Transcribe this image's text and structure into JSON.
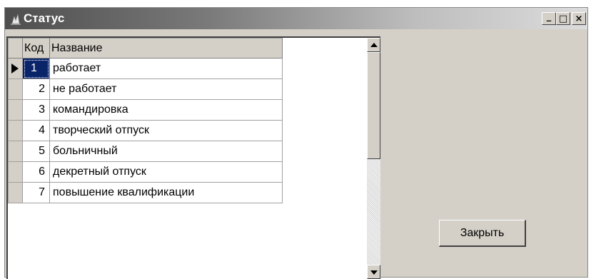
{
  "window": {
    "title": "Статус",
    "buttons": {
      "minimize": "_",
      "maximize": "□",
      "close": "×"
    }
  },
  "grid": {
    "columns": [
      "Код",
      "Название"
    ],
    "rows": [
      {
        "code": "1",
        "name": "работает",
        "selected": true
      },
      {
        "code": "2",
        "name": "не работает"
      },
      {
        "code": "3",
        "name": "командировка"
      },
      {
        "code": "4",
        "name": "творческий отпуск"
      },
      {
        "code": "5",
        "name": "больничный"
      },
      {
        "code": "6",
        "name": "декретный отпуск"
      },
      {
        "code": "7",
        "name": "повышение квалификации"
      }
    ]
  },
  "actions": {
    "close_label": "Закрыть"
  },
  "colors": {
    "face": "#d4d0c8",
    "selection": "#0a246a"
  }
}
